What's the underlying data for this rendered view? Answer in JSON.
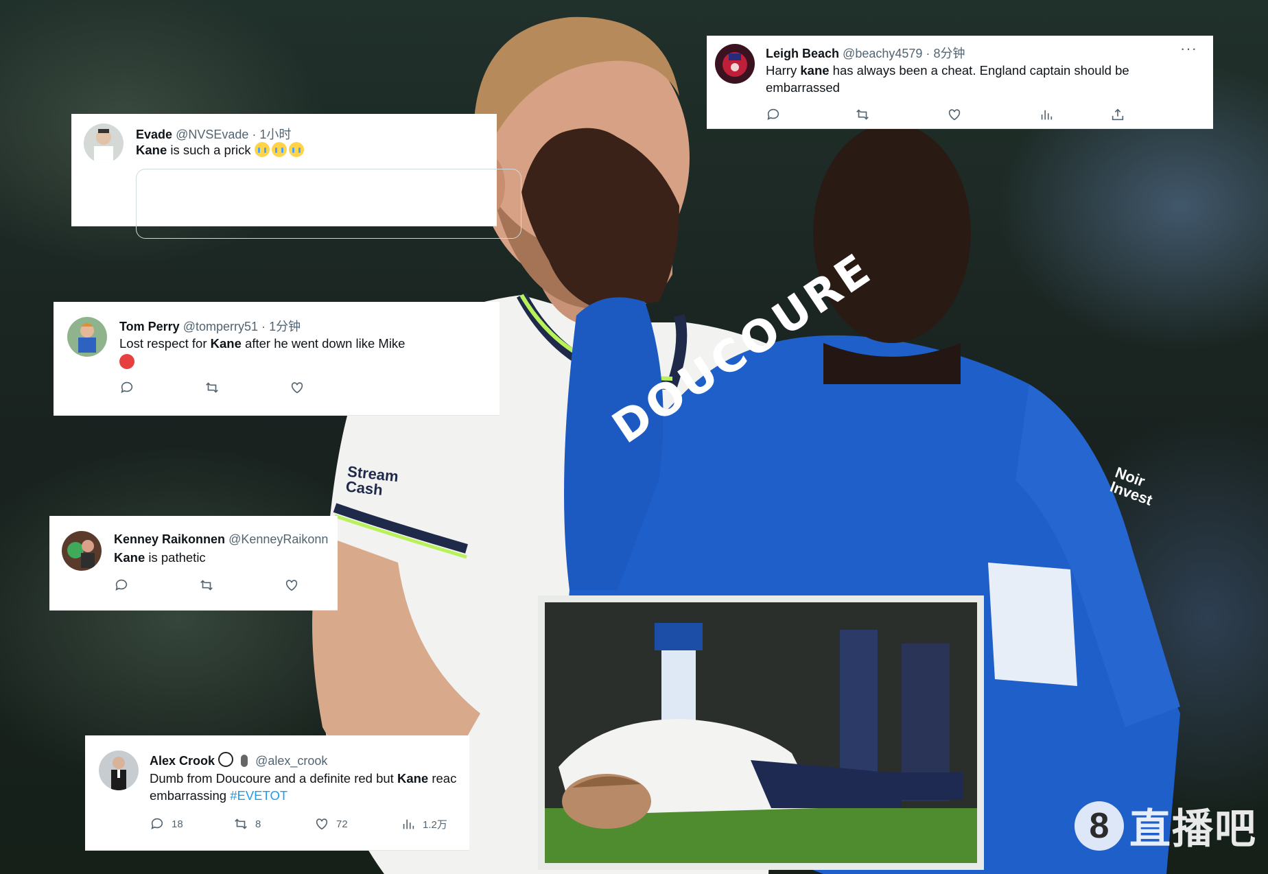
{
  "tweets": [
    {
      "id": "evade",
      "name": "Evade",
      "handle": "@NVSEvade",
      "time": "1小时",
      "sep": "·",
      "text_bold": "Kane",
      "text_rest": " is such a prick"
    },
    {
      "id": "leigh",
      "name": "Leigh Beach",
      "handle": "@beachy4579",
      "time": "8分钟",
      "sep": "·",
      "text_pre": "Harry ",
      "text_bold": "kane",
      "text_rest": " has always been a cheat. England captain should be embarrassed",
      "more": "···"
    },
    {
      "id": "tom",
      "name": "Tom Perry",
      "handle": "@tomperry51",
      "time": "1分钟",
      "sep": "·",
      "text_pre": "Lost respect for ",
      "text_bold": "Kane",
      "text_rest": " after he went down like Mike"
    },
    {
      "id": "kenney",
      "name": "Kenney Raikonnen",
      "handle": "@KenneyRaikonn",
      "text_bold": "Kane",
      "text_rest": " is pathetic"
    },
    {
      "id": "alex",
      "name": "Alex Crook",
      "handle": "@alex_crook",
      "text_pre": "Dumb from Doucoure and a definite red but ",
      "text_bold": "Kane",
      "text_rest": " reac",
      "line2": "embarrassing ",
      "hashtag": "#EVETOT",
      "replies": "18",
      "retweets": "8",
      "likes": "72",
      "views": "1.2万"
    }
  ],
  "jersey": {
    "name": "DOUCOURE",
    "sponsor_left": "Stream Cash",
    "sponsor_right": "Noir Invest"
  },
  "watermark": {
    "logo": "8",
    "text": "直播吧"
  },
  "icons": [
    "reply-icon",
    "retweet-icon",
    "like-icon",
    "views-icon",
    "share-icon"
  ]
}
